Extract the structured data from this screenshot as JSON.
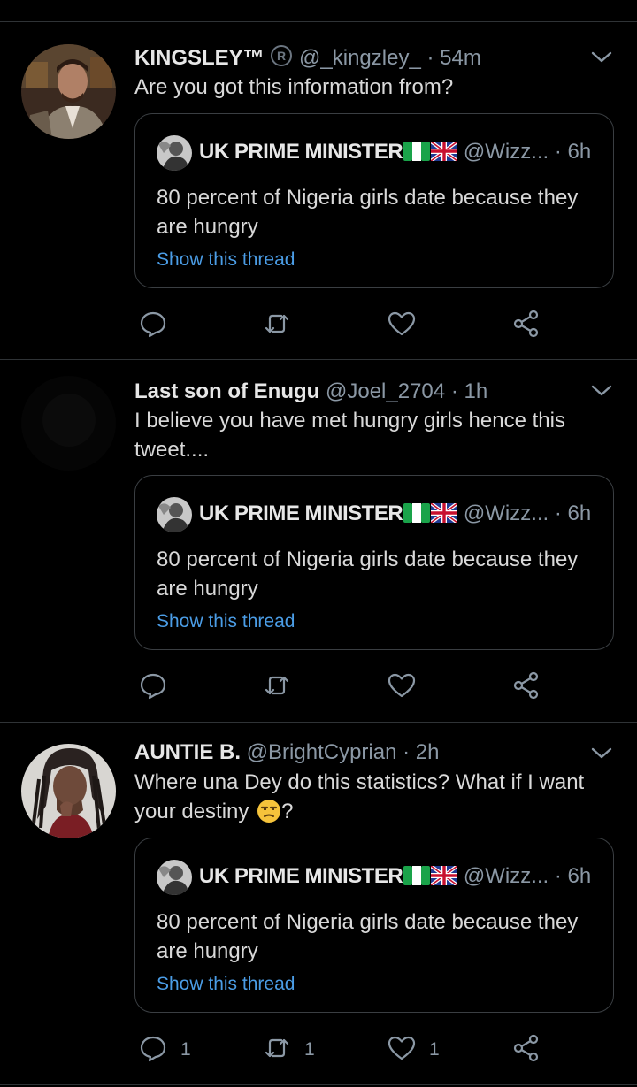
{
  "colors": {
    "background": "#000000",
    "text": "#d9d9d9",
    "secondary": "#8b98a5",
    "link": "#4b9de6",
    "border": "#2f3336"
  },
  "tweets": [
    {
      "name": "KINGSLEY™",
      "handle": "@_kingzley_",
      "time": "· 54m",
      "text": "Are you got this information from?",
      "quote": {
        "name": "UK PRIME MINISTER",
        "handle": "@Wizz...",
        "time": "· 6h",
        "text": "80 percent of Nigeria girls date because they are hungry",
        "link": "Show this thread"
      },
      "counts": {
        "reply": "",
        "retweet": "",
        "like": ""
      }
    },
    {
      "name": "Last son of Enugu",
      "handle": "@Joel_2704",
      "time": "· 1h",
      "text": "I believe you have met hungry girls hence this tweet....",
      "quote": {
        "name": "UK PRIME MINISTER",
        "handle": "@Wizz...",
        "time": "· 6h",
        "text": "80 percent of Nigeria girls date because they are hungry",
        "link": "Show this thread"
      },
      "counts": {
        "reply": "",
        "retweet": "",
        "like": ""
      }
    },
    {
      "name": "AUNTIE B.",
      "handle": "@BrightCyprian",
      "time": "· 2h",
      "text": "Where una Dey do this statistics? What if I want your destiny",
      "text_end": "?",
      "quote": {
        "name": "UK PRIME MINISTER",
        "handle": "@Wizz...",
        "time": "· 6h",
        "text": "80 percent of Nigeria girls date because they are hungry",
        "link": "Show this thread"
      },
      "counts": {
        "reply": "1",
        "retweet": "1",
        "like": "1"
      }
    }
  ]
}
